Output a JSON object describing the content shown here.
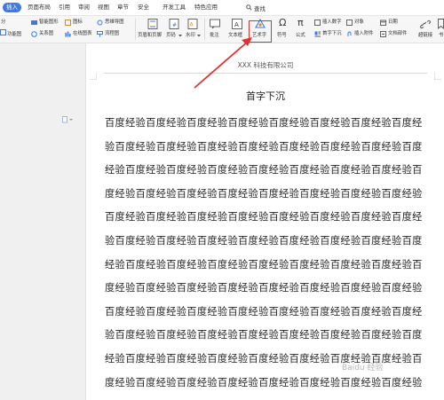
{
  "tabs": [
    {
      "label": "插入",
      "active": true
    },
    {
      "label": "页面布局"
    },
    {
      "label": "引用"
    },
    {
      "label": "审阅"
    },
    {
      "label": "视图"
    },
    {
      "label": "章节"
    },
    {
      "label": "安全"
    },
    {
      "label": "开发工具"
    },
    {
      "label": "特色应用"
    }
  ],
  "search": {
    "label": "查找"
  },
  "ribbon": {
    "fragment_left_1": "分",
    "fragment_left_2": "功能图",
    "smart_graphic": "智能图形",
    "icon_lib": "图标",
    "mind_map": "思维导图",
    "relation_graph": "关系图",
    "online_chart": "在线图表",
    "flowchart": "流程图",
    "page_cover": "页眉和页脚",
    "page_num": "页码",
    "watermark": "水印",
    "comment": "批注",
    "textbox": "文本框",
    "art_text": "艺术字",
    "symbol": "符号",
    "formula": "公式",
    "insert_number": "插入数字",
    "drop_cap": "首字下沉",
    "object": "对象",
    "insert_attachment": "插入附件",
    "date": "日期",
    "doc_parts": "文档部件",
    "hyperlink": "超链接",
    "bookmark": "书"
  },
  "document": {
    "header": "XXX 科技有限公司",
    "title": "首字下沉",
    "body": "百度经验百度经验百度经验百度经验百度经验百度经验百度经验百度经验百度经验百度经验百度经验百度经验百度经验百度经验百度经验百度经验百度经验百度经验百度经验百度经验百度经验百度经验百度经验百度经验百度经验百度经验百度经验百度经验百度经验百度经验百度经验百度经验百度经验百度经验百度经验百度经验百度经验百度经验百度经验百度经验百度经验百度经验百度经验百度经验百度经验百度经验百度经验百度经验百度经验百度经验百度经验百度经验百度经验百度经验百度经验百度经验百度经验百度经验百度经验百度经验百度经验百度经验百度经验百度经验百度经验百度经验百度经验百度经验百度经验百度经验百度经验百度经验百度经验百度经验百度经验百度经验百度经验百度经验百度经验百度经验百度经验百度经验百度经验百度经验百度经验百度经验百度经验百度经验百度经验百度经验百度经验百度经验百度经验百度经验百度经验百度经验百度经验百度经验百度经验百度经验百度经验百度经验百度经验百度经验百度经验百度经验百度经验百度经验百度经验百度经验百度经验百度经验百度经验百度经验百度经验百度经验百度经验百度经验百度经验百度经验百度经验百度经验百度经验百度经验百度经验百度经验百度经验百度经验百度经验百度经验百度经验百度经验百度经验百度经验百度经验百度经验百度经验百度经验百度经验百度经验百度经验百度经验百度经验"
  },
  "watermark_text": "Baidu 经验",
  "colors": {
    "accent": "#3d7ae6",
    "highlight": "#e53030"
  }
}
